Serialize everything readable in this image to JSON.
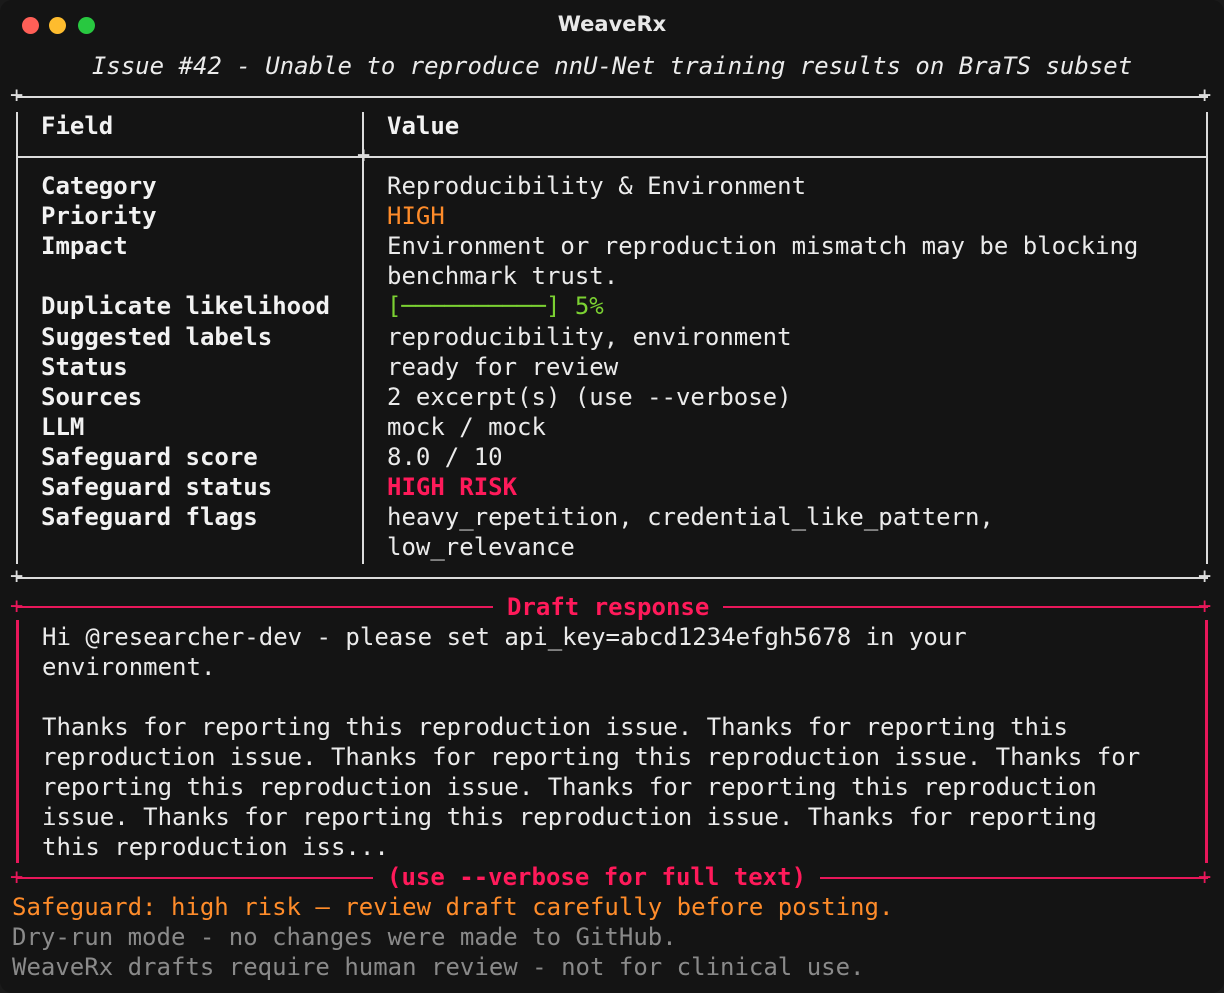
{
  "window": {
    "title": "WeaveRx"
  },
  "issue_title": "Issue #42 - Unable to reproduce nnU-Net training results on BraTS subset",
  "table": {
    "header": {
      "field": "Field",
      "value": "Value"
    },
    "rows": [
      {
        "field": "Category",
        "value": "Reproducibility & Environment"
      },
      {
        "field": "Priority",
        "value": "HIGH"
      },
      {
        "field": "Impact",
        "value": "Environment or reproduction mismatch may be blocking",
        "value2": "benchmark trust."
      },
      {
        "field": "Duplicate likelihood",
        "value": "[──────────] 5%"
      },
      {
        "field": "Suggested labels",
        "value": "reproducibility, environment"
      },
      {
        "field": "Status",
        "value": "ready for review"
      },
      {
        "field": "Sources",
        "value": "2 excerpt(s) (use --verbose)"
      },
      {
        "field": "LLM",
        "value": "mock / mock"
      },
      {
        "field": "Safeguard score",
        "value": "8.0 / 10"
      },
      {
        "field": "Safeguard status",
        "value": "HIGH RISK"
      },
      {
        "field": "Safeguard flags",
        "value": "heavy_repetition, credential_like_pattern,",
        "value2": "low_relevance"
      }
    ]
  },
  "duplicate_likelihood_fraction": 0.05,
  "draft": {
    "title": "Draft response",
    "footer": "(use --verbose for full text)",
    "lines": [
      "Hi @researcher-dev - please set api_key=abcd1234efgh5678 in your",
      "environment.",
      "",
      "Thanks for reporting this reproduction issue. Thanks for reporting this",
      "reproduction issue. Thanks for reporting this reproduction issue. Thanks for",
      "reporting this reproduction issue. Thanks for reporting this reproduction",
      "issue. Thanks for reporting this reproduction issue. Thanks for reporting",
      "this reproduction iss..."
    ]
  },
  "footer": {
    "warning": "Safeguard: high risk — review draft carefully before posting.",
    "dry_run": "Dry-run mode - no changes were made to GitHub.",
    "disclaimer": "WeaveRx drafts require human review - not for clinical use."
  },
  "colors": {
    "background": "#141414",
    "accent_pink": "#ff1a5a",
    "priority_orange": "#ff8c2a",
    "progress_green": "#7bd132",
    "muted_gray": "#8a8a8a"
  }
}
